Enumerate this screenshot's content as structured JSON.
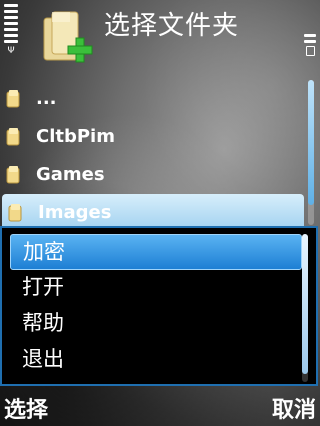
{
  "header": {
    "title": "选择文件夹",
    "icon": "folder-add-icon"
  },
  "status": {
    "signal_icon": "antenna-icon",
    "battery_icon": "battery-icon"
  },
  "list": {
    "items": [
      {
        "label": "..."
      },
      {
        "label": "CltbPim"
      },
      {
        "label": "Games"
      },
      {
        "label": "Images"
      }
    ],
    "selected_index": 3
  },
  "menu": {
    "items": [
      {
        "label": "加密"
      },
      {
        "label": "打开"
      },
      {
        "label": "帮助"
      },
      {
        "label": "退出"
      }
    ],
    "highlighted_index": 0
  },
  "softkeys": {
    "left": "选择",
    "right": "取消"
  },
  "colors": {
    "accent": "#1d7fd4",
    "selection": "#9fd0ef",
    "menu_bg": "#000000"
  }
}
